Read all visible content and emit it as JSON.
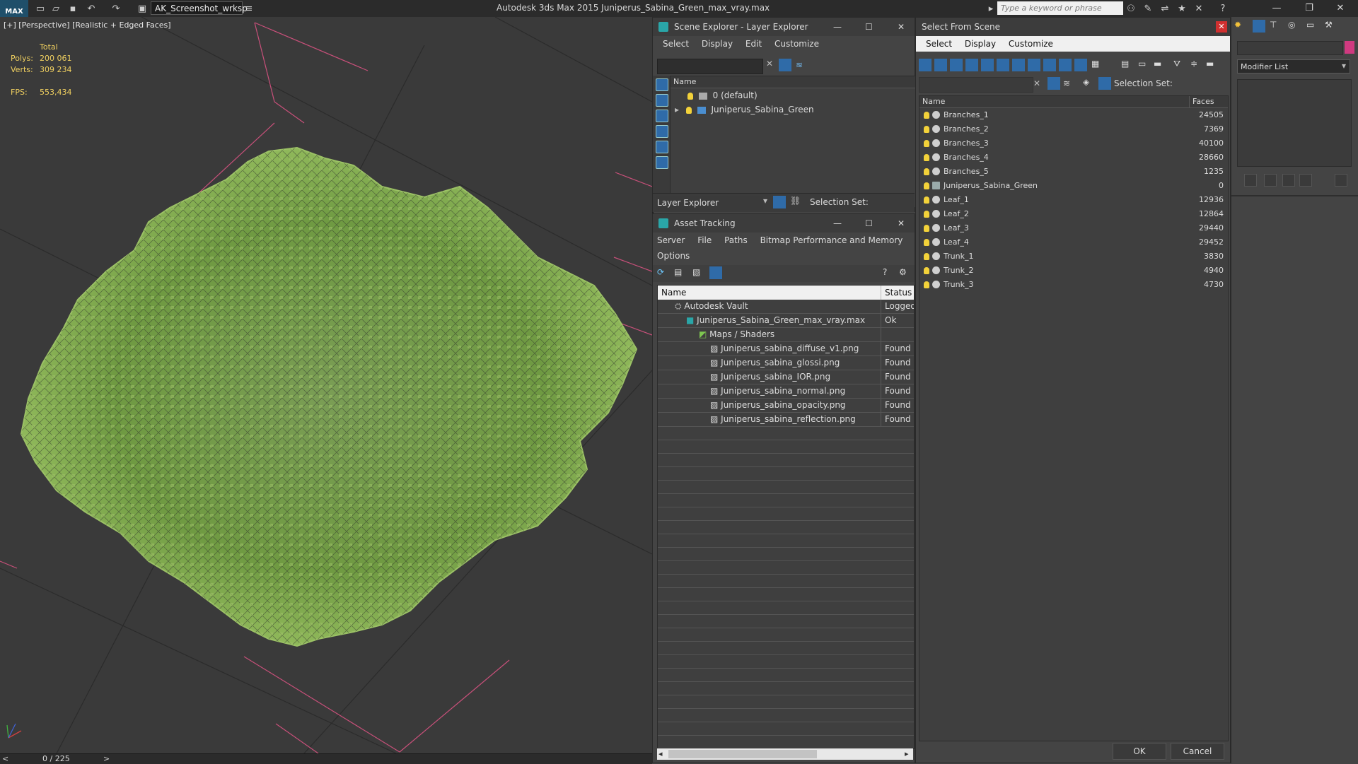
{
  "titlebar": {
    "logo": "MAX",
    "workspace": "AK_Screenshot_wrksp",
    "title": "Autodesk 3ds Max  2015    Juniperus_Sabina_Green_max_vray.max",
    "search_placeholder": "Type a keyword or phrase"
  },
  "viewport": {
    "label": "[+] [Perspective] [Realistic + Edged Faces]",
    "stats": {
      "total_label": "Total",
      "polys_label": "Polys:",
      "polys_value": "200 061",
      "verts_label": "Verts:",
      "verts_value": "309 234",
      "fps_label": "FPS:",
      "fps_value": "553,434"
    }
  },
  "timeline": {
    "prev": "<",
    "frame": "0 / 225",
    "next": ">"
  },
  "scene_explorer": {
    "title": "Scene Explorer - Layer Explorer",
    "menu": [
      "Select",
      "Display",
      "Edit",
      "Customize"
    ],
    "column_name": "Name",
    "rows": [
      {
        "label": "0 (default)"
      },
      {
        "label": "Juniperus_Sabina_Green"
      }
    ],
    "footer_dropdown": "Layer Explorer",
    "footer_selection": "Selection Set:"
  },
  "asset_tracking": {
    "title": "Asset Tracking",
    "menu": [
      "Server",
      "File",
      "Paths",
      "Bitmap Performance and Memory"
    ],
    "menu2": "Options",
    "col_name": "Name",
    "col_status": "Status",
    "rows": [
      {
        "name": "Autodesk Vault",
        "status": "Logged"
      },
      {
        "name": "Juniperus_Sabina_Green_max_vray.max",
        "status": "Ok"
      },
      {
        "name": "Maps / Shaders",
        "status": ""
      },
      {
        "name": "Juniperus_sabina_diffuse_v1.png",
        "status": "Found"
      },
      {
        "name": "Juniperus_sabina_glossi.png",
        "status": "Found"
      },
      {
        "name": "Juniperus_sabina_IOR.png",
        "status": "Found"
      },
      {
        "name": "Juniperus_sabina_normal.png",
        "status": "Found"
      },
      {
        "name": "Juniperus_sabina_opacity.png",
        "status": "Found"
      },
      {
        "name": "Juniperus_sabina_reflection.png",
        "status": "Found"
      }
    ]
  },
  "select_scene": {
    "title": "Select From Scene",
    "menu": [
      "Select",
      "Display",
      "Customize"
    ],
    "selection_set": "Selection Set:",
    "col_name": "Name",
    "col_faces": "Faces",
    "rows": [
      {
        "name": "Branches_1",
        "faces": "24505"
      },
      {
        "name": "Branches_2",
        "faces": "7369"
      },
      {
        "name": "Branches_3",
        "faces": "40100"
      },
      {
        "name": "Branches_4",
        "faces": "28660"
      },
      {
        "name": "Branches_5",
        "faces": "1235"
      },
      {
        "name": "Juniperus_Sabina_Green",
        "faces": "0"
      },
      {
        "name": "Leaf_1",
        "faces": "12936"
      },
      {
        "name": "Leaf_2",
        "faces": "12864"
      },
      {
        "name": "Leaf_3",
        "faces": "29440"
      },
      {
        "name": "Leaf_4",
        "faces": "29452"
      },
      {
        "name": "Trunk_1",
        "faces": "3830"
      },
      {
        "name": "Trunk_2",
        "faces": "4940"
      },
      {
        "name": "Trunk_3",
        "faces": "4730"
      }
    ],
    "ok": "OK",
    "cancel": "Cancel"
  },
  "command_panel": {
    "modifier_list": "Modifier List"
  },
  "colors": {
    "accent": "#2f6ba8",
    "foliage": "#7fa84a",
    "grid_highlight": "#d0507a",
    "stat_text": "#f0d060"
  }
}
